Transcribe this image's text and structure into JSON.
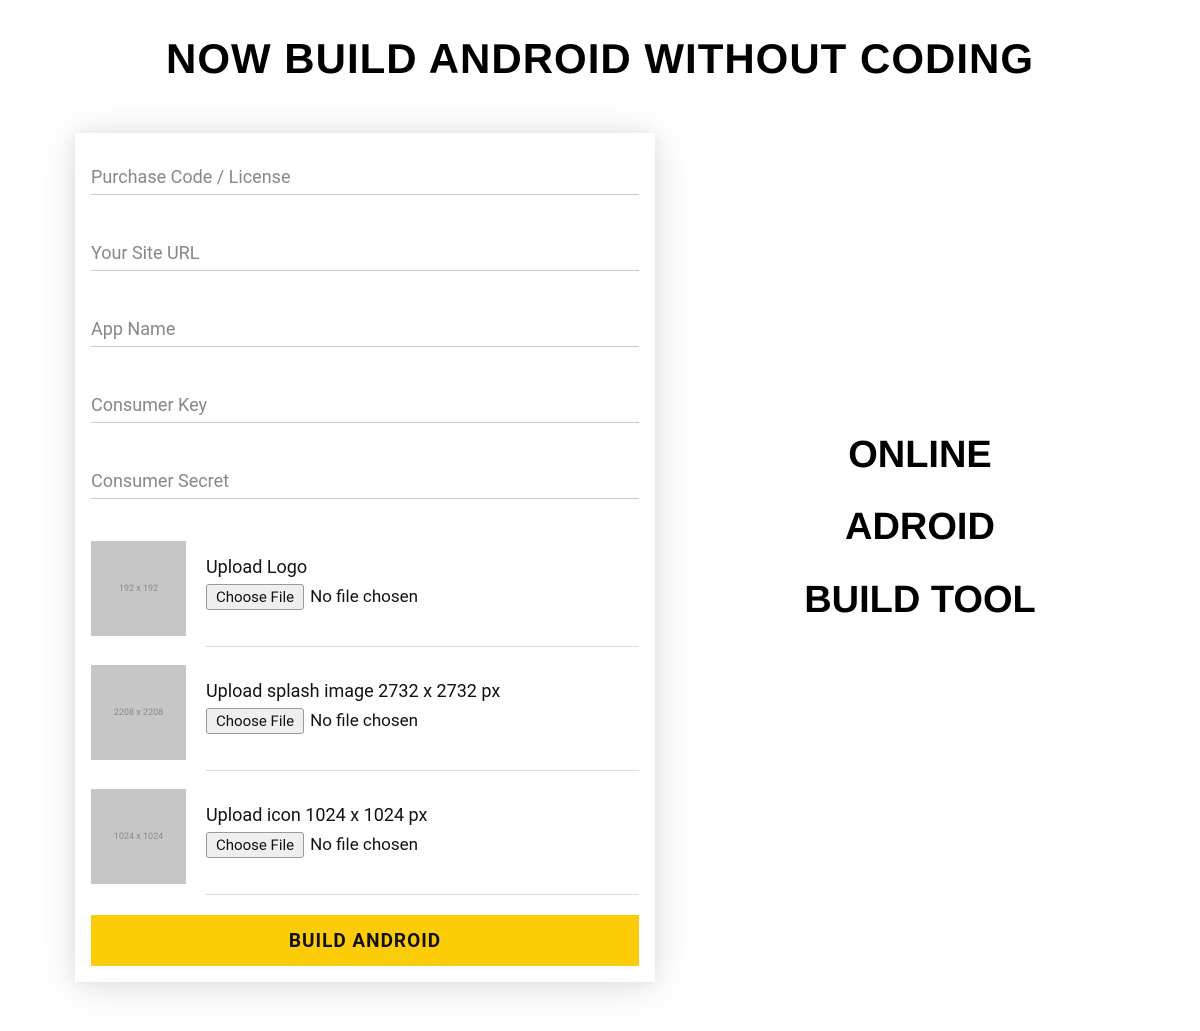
{
  "heading": "NOW BUILD ANDROID WITHOUT CODING",
  "sideHeading": {
    "line1": "ONLINE",
    "line2": "ADROID",
    "line3": "BUILD TOOL"
  },
  "form": {
    "fields": {
      "purchase": {
        "placeholder": "Purchase Code / License",
        "value": ""
      },
      "siteUrl": {
        "placeholder": "Your Site URL",
        "value": ""
      },
      "appName": {
        "placeholder": "App Name",
        "value": ""
      },
      "consumerKey": {
        "placeholder": "Consumer Key",
        "value": ""
      },
      "consumerSecret": {
        "placeholder": "Consumer Secret",
        "value": ""
      }
    },
    "uploads": {
      "logo": {
        "thumb": "192 x 192",
        "label": "Upload Logo",
        "button": "Choose File",
        "status": "No file chosen"
      },
      "splash": {
        "thumb": "2208 x 2208",
        "label": "Upload splash image 2732 x 2732 px",
        "button": "Choose File",
        "status": "No file chosen"
      },
      "icon": {
        "thumb": "1024 x 1024",
        "label": "Upload icon 1024 x 1024 px",
        "button": "Choose File",
        "status": "No file chosen"
      }
    },
    "submitLabel": "BUILD ANDROID"
  },
  "colors": {
    "accent": "#fdcc09"
  }
}
